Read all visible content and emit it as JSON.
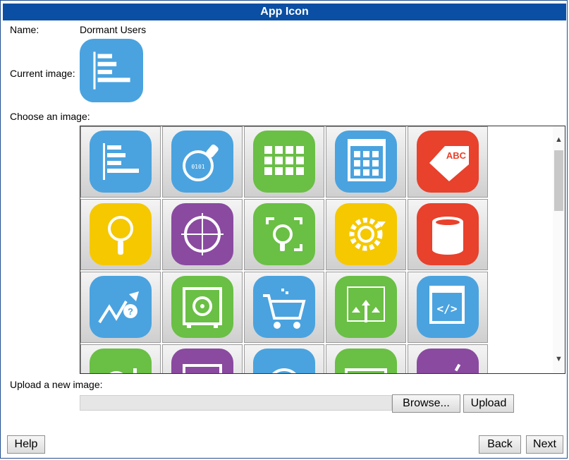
{
  "title": "App Icon",
  "name_label": "Name:",
  "name_value": "Dormant Users",
  "current_image_label": "Current image:",
  "current_image_icon": "bar-list-icon",
  "choose_label": "Choose an image:",
  "gallery": {
    "tiles": [
      {
        "icon": "bar-list-icon",
        "color": "#4aa3df"
      },
      {
        "icon": "binary-magnifier-icon",
        "color": "#4aa3df"
      },
      {
        "icon": "grid-apps-icon",
        "color": "#6abf45"
      },
      {
        "icon": "window-grid-icon",
        "color": "#4aa3df"
      },
      {
        "icon": "abc-tag-icon",
        "color": "#e8412c"
      },
      {
        "icon": "magnifier-icon",
        "color": "#f5c800"
      },
      {
        "icon": "crosshair-icon",
        "color": "#8a4aa0"
      },
      {
        "icon": "focus-magnifier-icon",
        "color": "#6abf45"
      },
      {
        "icon": "gear-cycle-icon",
        "color": "#f5c800"
      },
      {
        "icon": "database-icon",
        "color": "#e8412c"
      },
      {
        "icon": "trend-question-icon",
        "color": "#4aa3df"
      },
      {
        "icon": "vault-icon",
        "color": "#6abf45"
      },
      {
        "icon": "shopping-cart-icon",
        "color": "#4aa3df"
      },
      {
        "icon": "arrows-converge-icon",
        "color": "#6abf45"
      },
      {
        "icon": "code-window-icon",
        "color": "#4aa3df"
      },
      {
        "icon": "magnifier-exclaim-icon",
        "color": "#6abf45"
      },
      {
        "icon": "window-list-icon",
        "color": "#8a4aa0"
      },
      {
        "icon": "gauge-icon",
        "color": "#4aa3df"
      },
      {
        "icon": "memory-chip-icon",
        "color": "#6abf45"
      },
      {
        "icon": "shapes-icon",
        "color": "#8a4aa0"
      }
    ]
  },
  "upload_label": "Upload a new image:",
  "browse_label": "Browse...",
  "upload_button": "Upload",
  "help_button": "Help",
  "back_button": "Back",
  "next_button": "Next"
}
